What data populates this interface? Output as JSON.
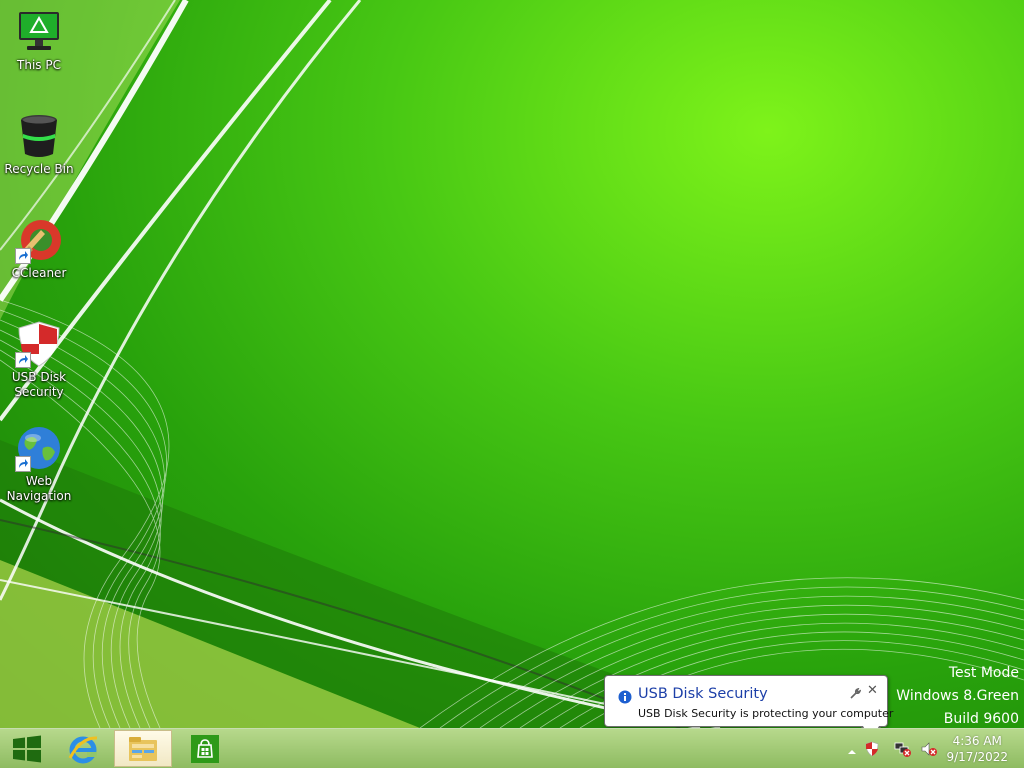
{
  "desktop": {
    "icons": [
      {
        "label": "This PC"
      },
      {
        "label": "Recycle Bin"
      },
      {
        "label": "CCleaner"
      },
      {
        "label": "USB Disk Security"
      },
      {
        "label": "Web Navigation"
      }
    ]
  },
  "watermark": {
    "line1": "Test Mode",
    "line2": "Windows 8.Green",
    "line3": "Build 9600"
  },
  "notification": {
    "title": "USB Disk Security",
    "message": "USB Disk Security is protecting your computer",
    "close_label": "✕"
  },
  "taskbar": {
    "buttons": [
      "start-icon",
      "internet-explorer-icon",
      "file-explorer-icon",
      "store-icon"
    ],
    "tray": {
      "time": "4:36 AM",
      "date": "9/17/2022"
    }
  },
  "colors": {
    "desktop_green": "#48c814",
    "notification_title": "#1c3fa8"
  }
}
